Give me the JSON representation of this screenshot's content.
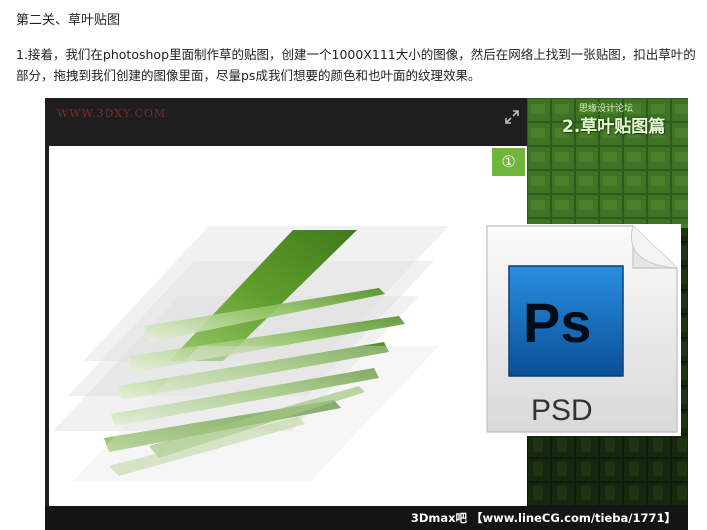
{
  "heading": "第二关、草叶贴图",
  "paragraph": "1.接着，我们在photoshop里面制作草的贴图，创建一个1000X111大小的图像，然后在网络上找到一张贴图，扣出草叶的部分，拖拽到我们创建的图像里面，尽量ps成我们想要的颜色和也叶面的纹理效果。",
  "figure": {
    "watermark": "WWW.3DXY.COM",
    "step_badge": "①",
    "texture_panel_title": "2.草叶贴图篇",
    "texture_panel_subtitle": "思缘设计论坛",
    "psd_icon": {
      "app_label": "Ps",
      "file_label": "PSD"
    },
    "footer_credit": "3Dmax吧 【www.lineCG.com/tieba/1771】",
    "colors": {
      "badge": "#6fb63a",
      "ps_blue": "#0a64b4",
      "grass": "#6aa93a"
    }
  }
}
